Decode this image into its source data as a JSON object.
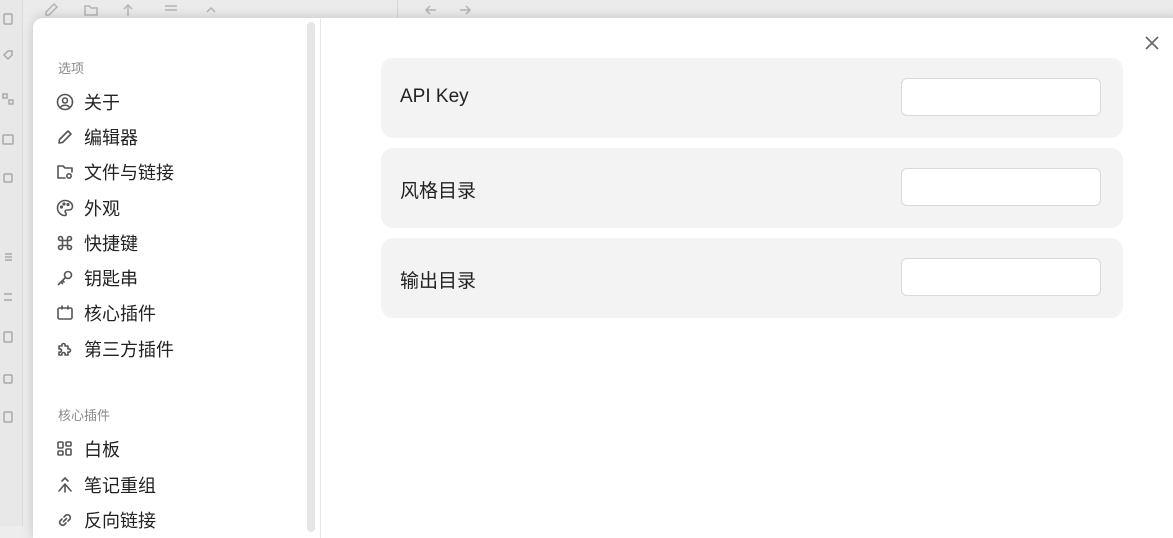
{
  "sidebar": {
    "section_options": "选项",
    "section_core_plugins": "核心插件",
    "items": [
      {
        "label": "关于",
        "icon": "user-circle-icon"
      },
      {
        "label": "编辑器",
        "icon": "pencil-icon"
      },
      {
        "label": "文件与链接",
        "icon": "folder-cog-icon"
      },
      {
        "label": "外观",
        "icon": "palette-icon"
      },
      {
        "label": "快捷键",
        "icon": "command-icon"
      },
      {
        "label": "钥匙串",
        "icon": "key-icon"
      },
      {
        "label": "核心插件",
        "icon": "calendar-box-icon"
      },
      {
        "label": "第三方插件",
        "icon": "puzzle-icon"
      }
    ],
    "core_items": [
      {
        "label": "白板",
        "icon": "grid-icon"
      },
      {
        "label": "笔记重组",
        "icon": "merge-arrow-icon"
      },
      {
        "label": "反向链接",
        "icon": "link-icon"
      }
    ]
  },
  "settings": [
    {
      "label": "API Key",
      "value": "",
      "placeholder": ""
    },
    {
      "label": "风格目录",
      "value": "",
      "placeholder": ""
    },
    {
      "label": "输出目录",
      "value": "",
      "placeholder": ""
    }
  ],
  "colors": {
    "modal_bg": "#ffffff",
    "row_bg": "#f3f3f3",
    "backdrop": "#ededed"
  }
}
